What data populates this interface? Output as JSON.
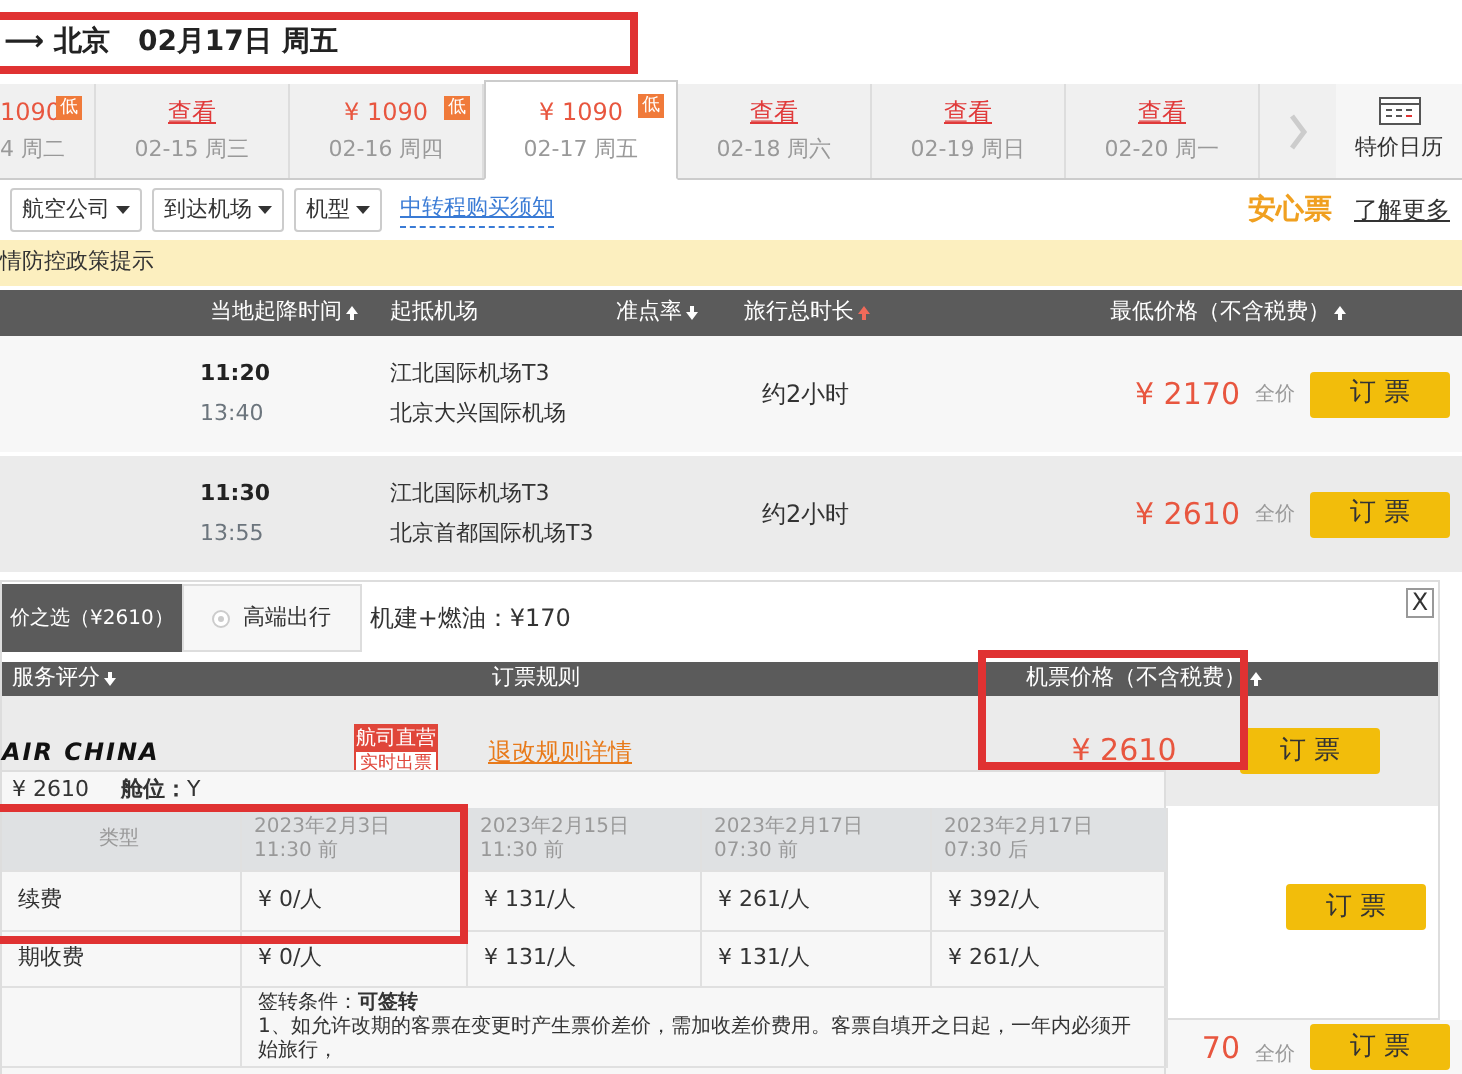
{
  "header": {
    "route": "⟶ 北京",
    "date": "02月17日 周五",
    "highlighted": true
  },
  "date_tabs": [
    {
      "kind": "price",
      "price": "1090",
      "date": "4 周二",
      "badge": "低",
      "selected": false
    },
    {
      "kind": "view",
      "link": "查看",
      "date": "02-15 周三",
      "selected": false
    },
    {
      "kind": "price",
      "price": "¥ 1090",
      "date": "02-16 周四",
      "badge": "低",
      "selected": false
    },
    {
      "kind": "price",
      "price": "¥ 1090",
      "date": "02-17 周五",
      "badge": "低",
      "selected": true
    },
    {
      "kind": "view",
      "link": "查看",
      "date": "02-18 周六",
      "selected": false
    },
    {
      "kind": "view",
      "link": "查看",
      "date": "02-19 周日",
      "selected": false
    },
    {
      "kind": "view",
      "link": "查看",
      "date": "02-20 周一",
      "selected": false
    }
  ],
  "calendar_label": "特价日历",
  "filters": [
    "航空公司",
    "到达机场",
    "机型"
  ],
  "transfer_link": "中转程购买须知",
  "brand": "安心票",
  "more_link": "了解更多",
  "notice": "情防控政策提示",
  "columns": [
    {
      "label": "当地起降时间",
      "sort_desc": false,
      "active": false
    },
    {
      "label": "起抵机场"
    },
    {
      "label": "准点率",
      "sort_desc": true,
      "active": false
    },
    {
      "label": "旅行总时长",
      "sort_desc": false,
      "active": true
    },
    {
      "label": "最低价格（不含税费）",
      "sort_desc": false,
      "active": false
    }
  ],
  "flights": [
    {
      "depart": "11:20",
      "arrive": "13:40",
      "from": "江北国际机场T3",
      "to": "北京大兴国际机场",
      "duration": "约2小时",
      "price": "¥ 2170",
      "fare": "全价",
      "book": "订 票",
      "expanded": false
    },
    {
      "depart": "11:30",
      "arrive": "13:55",
      "from": "江北国际机场T3",
      "to": "北京首都国际机场T3",
      "duration": "约2小时",
      "price": "¥ 2610",
      "fare": "全价",
      "book": "订 票",
      "expanded": true
    },
    {
      "price": "70",
      "fare": "全价",
      "book": "订 票",
      "expanded": false
    }
  ],
  "detail": {
    "tabs": [
      {
        "label": "价之选（¥2610）",
        "selected": true
      },
      {
        "label": "高端出行",
        "selected": false
      }
    ],
    "fees": "机建+燃油：¥170",
    "close": "X",
    "columns": [
      {
        "label": "服务评分",
        "sort_desc": true
      },
      {
        "label": "订票规则"
      },
      {
        "label": "机票价格（不含税费）",
        "sort_desc": false
      }
    ],
    "offers": [
      {
        "airline": "AIR CHINA",
        "badge_top": "航司直营",
        "badge_bottom": "实时出票",
        "rule_link": "退改规则详情",
        "price": "¥ 2610",
        "price_highlighted": true,
        "book": "订 票"
      },
      {
        "book": "订 票"
      }
    ]
  },
  "rules_popup": {
    "price": "¥ 2610",
    "cabin_label": "舱位：",
    "cabin": "Y",
    "highlighted": true,
    "columns": [
      "类型",
      "2023年2月3日 11:30 前",
      "2023年2月15日 11:30 前",
      "2023年2月17日 07:30 前",
      "2023年2月17日 07:30 后"
    ],
    "rows": [
      {
        "type": "续费",
        "values": [
          "¥ 0/人",
          "¥ 131/人",
          "¥ 261/人",
          "¥ 392/人"
        ]
      },
      {
        "type": "期收费",
        "values": [
          "¥ 0/人",
          "¥ 131/人",
          "¥ 131/人",
          "¥ 261/人"
        ]
      }
    ],
    "endorse": "签转条件：**可签转**",
    "note": "1、如允许改期的客票在变更时产生票价差价，需加收差价费用。客票自填开之日起，一年内必须开始旅行，"
  }
}
